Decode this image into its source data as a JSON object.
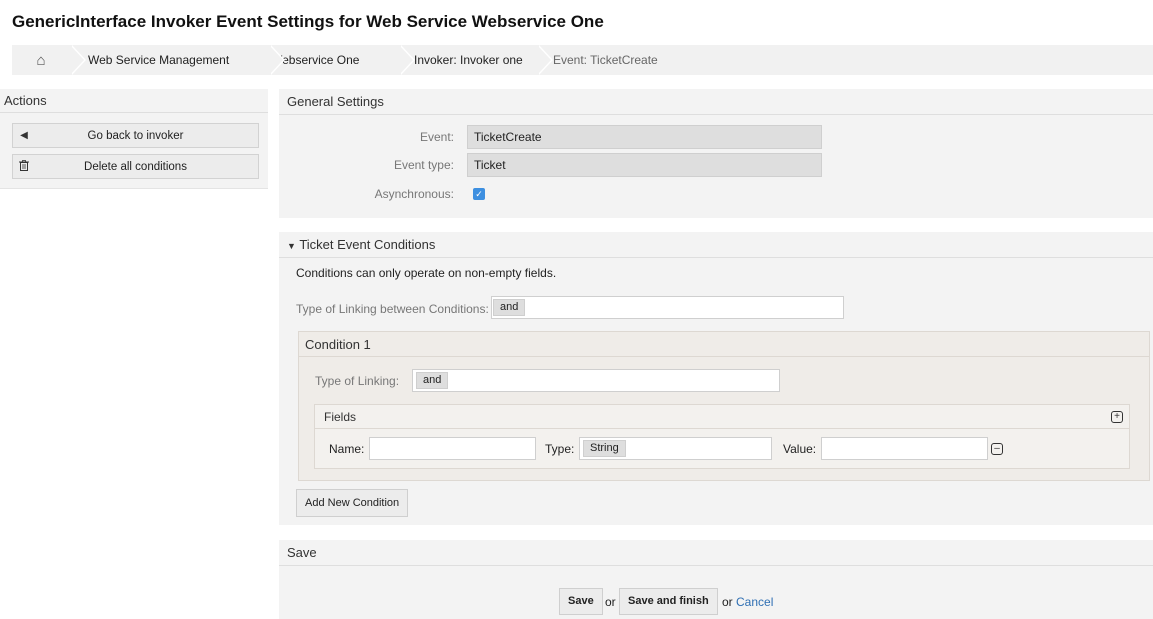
{
  "page": {
    "title": "GenericInterface Invoker Event Settings for Web Service Webservice One"
  },
  "breadcrumb": {
    "home_icon": "home-icon",
    "items": [
      "Web Service Management",
      "Webservice One",
      "Invoker: Invoker one",
      "Event: TicketCreate"
    ]
  },
  "sidebar": {
    "title": "Actions",
    "buttons": [
      {
        "label": "Go back to invoker",
        "icon": "caret-left-icon"
      },
      {
        "label": "Delete all conditions",
        "icon": "trash-icon"
      }
    ]
  },
  "general": {
    "title": "General Settings",
    "event_label": "Event:",
    "event_value": "TicketCreate",
    "event_type_label": "Event type:",
    "event_type_value": "Ticket",
    "async_label": "Asynchronous:",
    "async_checked": true
  },
  "conditions": {
    "title": "Ticket Event Conditions",
    "note": "Conditions can only operate on non-empty fields.",
    "linking_label": "Type of Linking between Conditions:",
    "linking_value": "and",
    "condition": {
      "title": "Condition 1",
      "linking_label": "Type of Linking:",
      "linking_value": "and",
      "fields": {
        "title": "Fields",
        "name_label": "Name:",
        "name_value": "",
        "type_label": "Type:",
        "type_value": "String",
        "value_label": "Value:",
        "value_value": ""
      }
    },
    "add_button": "Add New Condition"
  },
  "save": {
    "title": "Save",
    "save_button": "Save",
    "or1": "or",
    "save_finish_button": "Save and finish",
    "or2": "or",
    "cancel_link": "Cancel"
  },
  "colors": {
    "accent_link": "#2f6fb3",
    "checkbox": "#3d8fe0",
    "panel_bg": "#f3f3f3"
  }
}
